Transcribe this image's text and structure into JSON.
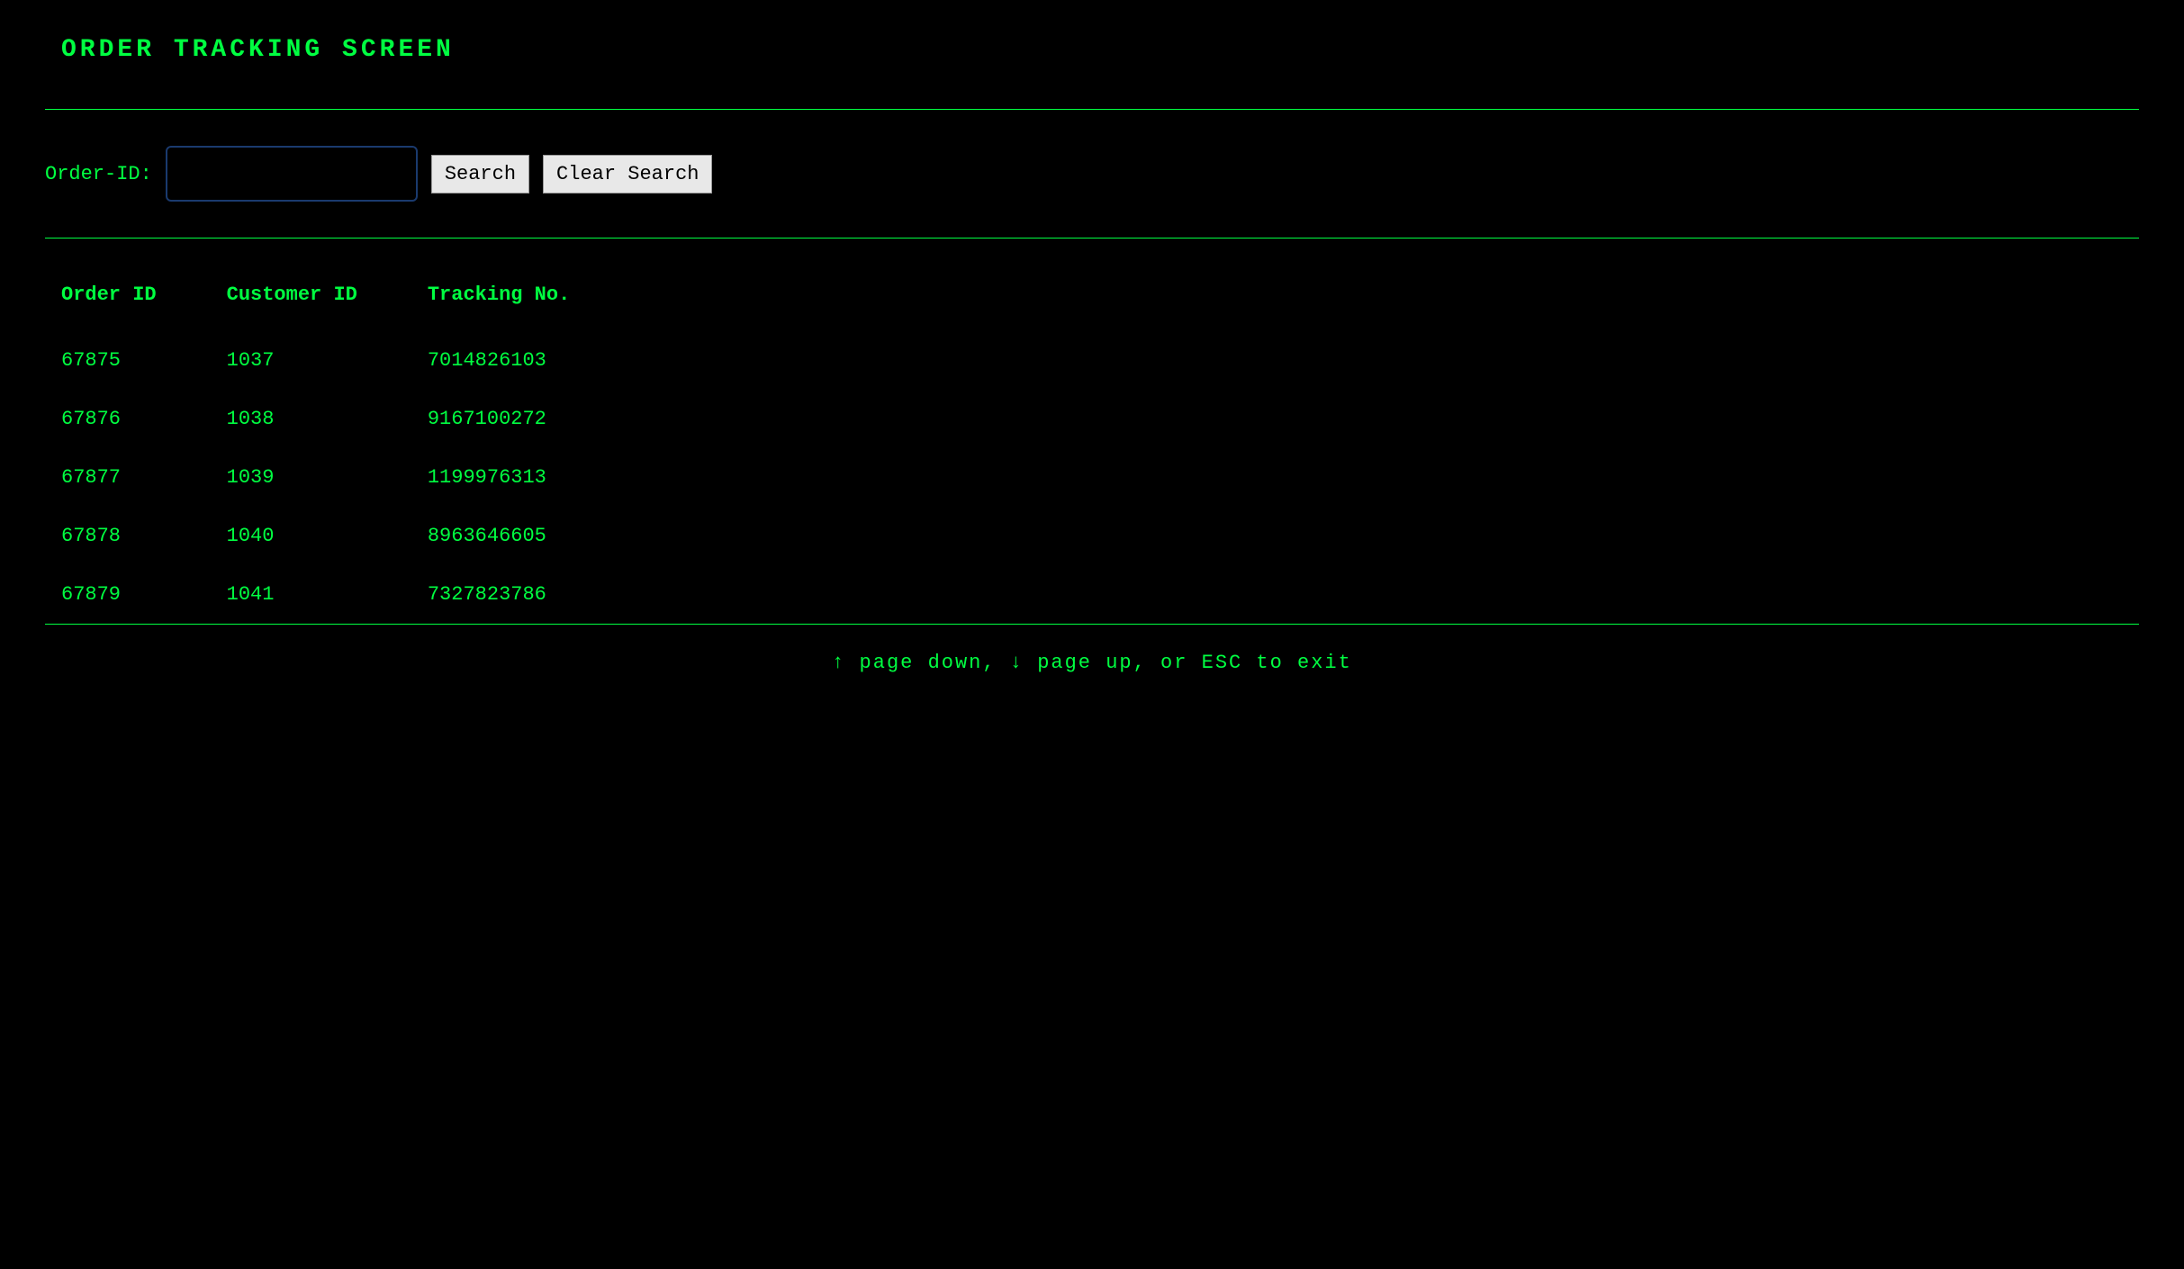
{
  "title": "ORDER TRACKING SCREEN",
  "search": {
    "label": "Order-ID:",
    "value": "",
    "search_button": "Search",
    "clear_button": "Clear Search"
  },
  "table": {
    "headers": [
      "Order ID",
      "Customer ID",
      "Tracking No."
    ],
    "rows": [
      {
        "order_id": "67875",
        "customer_id": "1037",
        "tracking_no": "7014826103"
      },
      {
        "order_id": "67876",
        "customer_id": "1038",
        "tracking_no": "9167100272"
      },
      {
        "order_id": "67877",
        "customer_id": "1039",
        "tracking_no": "1199976313"
      },
      {
        "order_id": "67878",
        "customer_id": "1040",
        "tracking_no": "8963646605"
      },
      {
        "order_id": "67879",
        "customer_id": "1041",
        "tracking_no": "7327823786"
      }
    ]
  },
  "footer_hint": "↑ page down, ↓ page up, or ESC to exit"
}
